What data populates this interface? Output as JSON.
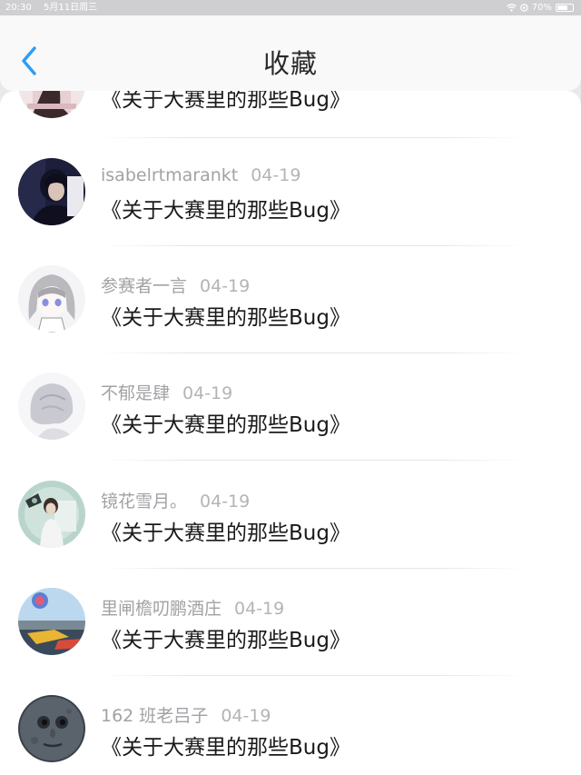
{
  "status_bar": {
    "time": "20:30",
    "date": "5月11日周三",
    "battery_percent": "70%",
    "battery_level": 0.7,
    "icons": [
      "wifi-icon",
      "location-icon",
      "battery-icon"
    ]
  },
  "header": {
    "title": "收藏",
    "back_icon": "chevron-left-icon",
    "accent_color": "#2f9cf2"
  },
  "favorites": [
    {
      "username": "",
      "date": "",
      "title": "《关于大赛里的那些Bug》"
    },
    {
      "username": "isabelrtmarankt",
      "date": "04-19",
      "title": "《关于大赛里的那些Bug》"
    },
    {
      "username": "参赛者一言",
      "date": "04-19",
      "title": "《关于大赛里的那些Bug》"
    },
    {
      "username": "不郁是肆",
      "date": "04-19",
      "title": "《关于大赛里的那些Bug》"
    },
    {
      "username": "镜花雪月。",
      "date": "04-19",
      "title": "《关于大赛里的那些Bug》"
    },
    {
      "username": "里闸檐叨鹏酒庄",
      "date": "04-19",
      "title": "《关于大赛里的那些Bug》"
    },
    {
      "username": "162 班老吕子",
      "date": "04-19",
      "title": "《关于大赛里的那些Bug》"
    }
  ]
}
